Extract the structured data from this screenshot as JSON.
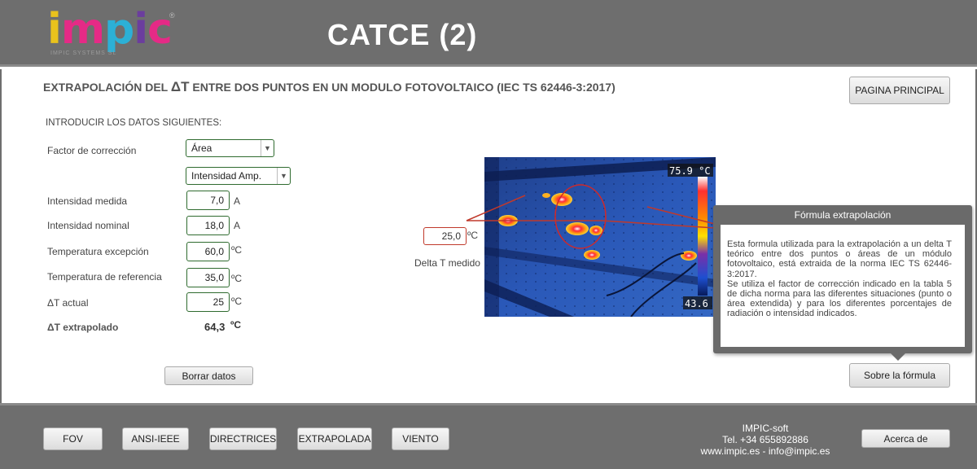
{
  "header": {
    "logo_text": "impic",
    "logo_tagline": "IMPIC SYSTEMS SL",
    "app_title": "CATCE (2)"
  },
  "main": {
    "title_prefix": "EXTRAPOLACIÓN DEL ",
    "title_delta": "ΔT",
    "title_suffix": " ENTRE DOS PUNTOS EN UN MODULO FOTOVOLTAICO (IEC TS 62446-3:2017)",
    "home_button": "PAGINA PRINCIPAL",
    "instructions": "INTRODUCIR LOS DATOS SIGUIENTES:",
    "correction_factor": {
      "label": "Factor de corrección",
      "selected": "Área",
      "secondary_selected": "Intensidad Amp."
    },
    "fields": [
      {
        "label": "Intensidad medida",
        "value": "7,0",
        "unit": "A"
      },
      {
        "label": "Intensidad nominal",
        "value": "18,0",
        "unit": "A"
      },
      {
        "label": "Temperatura excepción",
        "value": "60,0",
        "unit": "ºC"
      },
      {
        "label": "Temperatura de referencia",
        "value": "35,0",
        "unit": "ºC"
      },
      {
        "label": "ΔT actual",
        "value": "25",
        "unit": "ºC"
      }
    ],
    "result": {
      "label": "ΔT extrapolado",
      "value": "64,3",
      "unit": "ºC"
    },
    "clear_button": "Borrar datos",
    "thermal": {
      "max_temp": "75.9 °C",
      "min_temp": "43.6",
      "delta_value": "25,0",
      "delta_unit": "ºC",
      "delta_label": "Delta T medido"
    },
    "tooltip": {
      "title": "Fórmula extrapolación",
      "text_1": "Esta formula utilizada para la extrapolación a un delta T teórico entre dos puntos o áreas de un módulo fotovoltaico, está extraida de la norma IEC TS 62446-3:2017.",
      "text_2": "Se utiliza el factor de corrección indicado en la tabla 5 de dicha norma para las diferentes situaciones (punto o área extendida) y para los diferentes porcentajes de radiación o intensidad indicados."
    },
    "formula_button": "Sobre la fórmula"
  },
  "footer": {
    "nav": [
      "FOV",
      "ANSI-IEEE",
      "DIRECTRICES",
      "EXTRAPOLADA",
      "VIENTO"
    ],
    "company": "IMPIC-soft",
    "phone": "Tel. +34 655892886",
    "web": "www.impic.es - info@impic.es",
    "about_button": "Acerca de"
  },
  "colors": {
    "chrome_gray": "#6e6e6e",
    "field_border": "#2f6b2f",
    "highlight_red": "#c0392b"
  }
}
